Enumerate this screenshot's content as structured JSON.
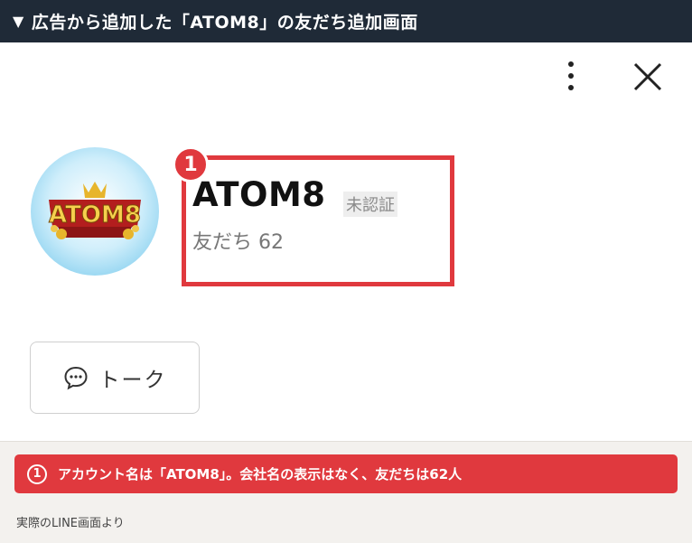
{
  "header": {
    "triangle": "▼",
    "title": "広告から追加した「ATOM8」の友だち追加画面"
  },
  "toolbar": {
    "menu_icon": "kebab-menu-icon",
    "close_icon": "close-icon"
  },
  "profile": {
    "logo_text": "ATOM8",
    "account_name": "ATOM8",
    "verification_badge": "未認証",
    "friends_label": "友だち 62",
    "marker_number": "1"
  },
  "talk_button": {
    "icon": "chat-bubble-icon",
    "label": "トーク"
  },
  "note": {
    "number": "1",
    "text": "アカウント名は「ATOM8」。会社名の表示はなく、友だちは62人"
  },
  "source": {
    "text": "実際のLINE画面より"
  },
  "colors": {
    "accent_red": "#e0393e",
    "header_bg": "#1f2a37",
    "bottom_bg": "#f3f1ee"
  }
}
